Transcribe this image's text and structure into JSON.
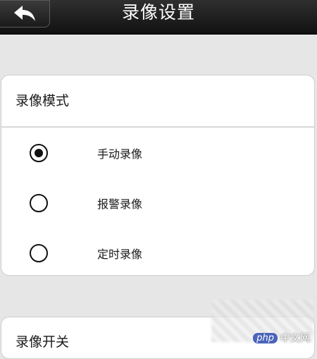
{
  "header": {
    "title": "录像设置",
    "back_icon": "back-arrow-icon"
  },
  "record_mode": {
    "title": "录像模式",
    "options": [
      {
        "label": "手动录像",
        "selected": true
      },
      {
        "label": "报警录像",
        "selected": false
      },
      {
        "label": "定时录像",
        "selected": false
      }
    ]
  },
  "record_switch": {
    "title": "录像开关"
  },
  "watermark": {
    "badge": "php",
    "text": "中文网"
  },
  "colors": {
    "titlebar": "#1a1a1a",
    "background": "#e6e6e6",
    "card": "#ffffff"
  }
}
